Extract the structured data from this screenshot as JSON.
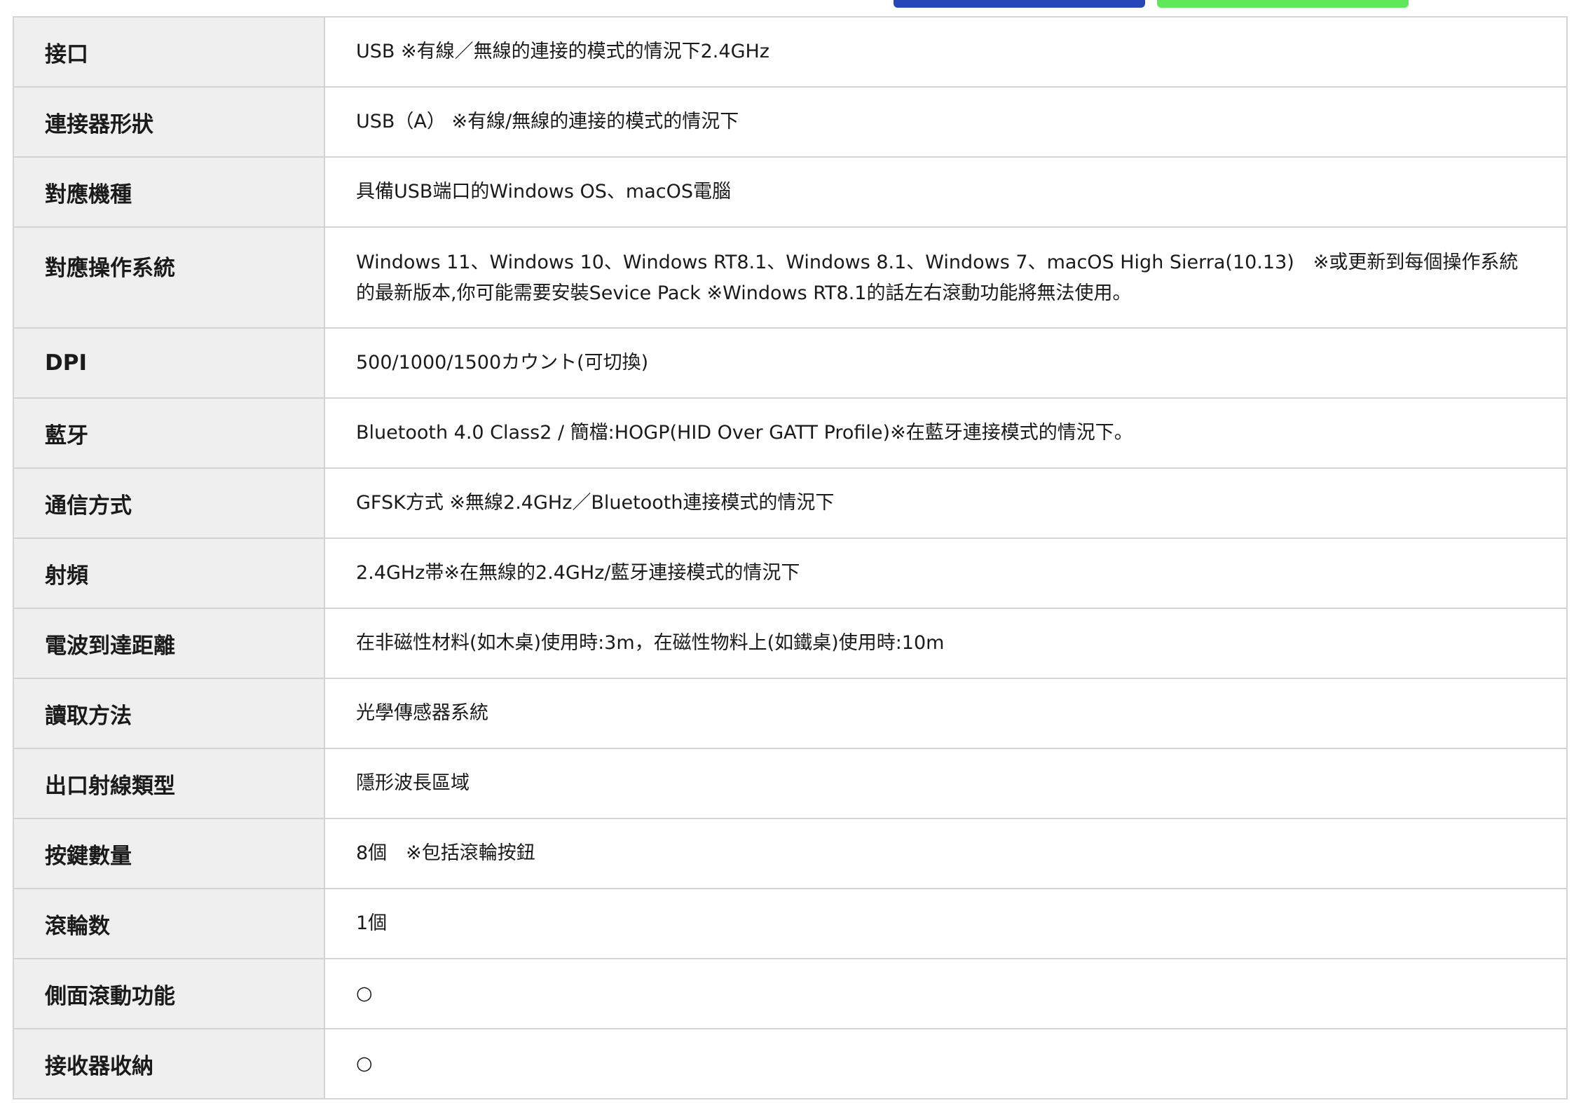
{
  "specs": [
    {
      "label": "接口",
      "value": "USB ※有線／無線的連接的模式的情況下2.4GHz"
    },
    {
      "label": "連接器形狀",
      "value": "USB（A） ※有線/無線的連接的模式的情況下"
    },
    {
      "label": "對應機種",
      "value": "具備USB端口的Windows OS、macOS電腦"
    },
    {
      "label": "對應操作系統",
      "value": "Windows 11、Windows 10、Windows RT8.1、Windows 8.1、Windows 7、macOS High Sierra(10.13)　※或更新到每個操作系統的最新版本,你可能需要安裝Sevice Pack ※Windows RT8.1的話左右滾動功能將無法使用。"
    },
    {
      "label": "DPI",
      "value": "500/1000/1500カウント(可切換)"
    },
    {
      "label": "藍牙",
      "value": "Bluetooth 4.0 Class2 / 簡檔:HOGP(HID Over GATT Profile)※在藍牙連接模式的情況下。"
    },
    {
      "label": "通信方式",
      "value": "GFSK方式 ※無線2.4GHz／Bluetooth連接模式的情況下"
    },
    {
      "label": "射頻",
      "value": "2.4GHz帯※在無線的2.4GHz/藍牙連接模式的情況下"
    },
    {
      "label": "電波到達距離",
      "value": "在非磁性材料(如木桌)使用時:3m，在磁性物料上(如鐵桌)使用時:10m"
    },
    {
      "label": "讀取方法",
      "value": "光學傳感器系統"
    },
    {
      "label": "出口射線類型",
      "value": "隱形波長區域"
    },
    {
      "label": "按鍵數量",
      "value": "8個　※包括滾輪按鈕"
    },
    {
      "label": "滾輪数",
      "value": "1個"
    },
    {
      "label": "側面滾動功能",
      "value": "○"
    },
    {
      "label": "接收器收納",
      "value": "○"
    }
  ]
}
